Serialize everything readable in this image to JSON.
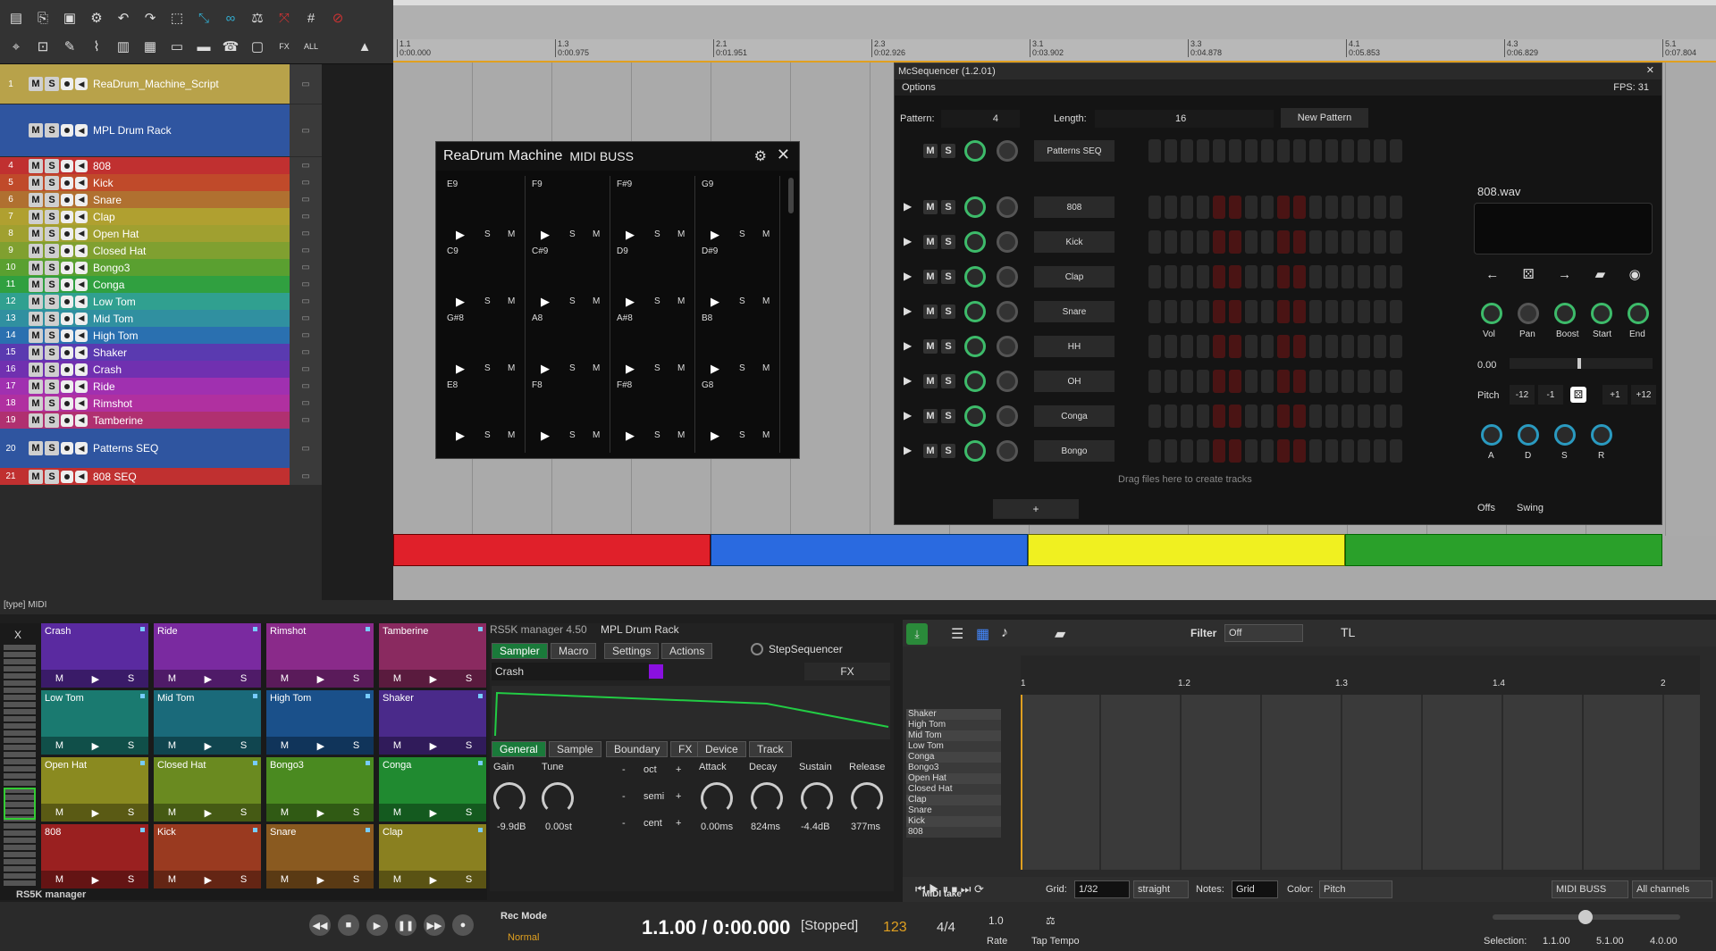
{
  "toolbar": {
    "icons": [
      "new-icon",
      "open-icon",
      "save-icon",
      "settings-icon",
      "undo-icon",
      "redo-icon",
      "select-icon",
      "ripple-icon",
      "link-icon",
      "metronome-icon",
      "snap-icon",
      "grid-icon",
      "lock-icon"
    ]
  },
  "tracks": [
    {
      "num": "1",
      "name": "ReaDrum_Machine_Script",
      "color": "#b8a24a",
      "kind": "A"
    },
    {
      "num": "",
      "name": "MPL Drum Rack",
      "color": "#2f55a0",
      "kind": ""
    },
    {
      "num": "4",
      "name": "808",
      "color": "#c03030"
    },
    {
      "num": "5",
      "name": "Kick",
      "color": "#c04a2a"
    },
    {
      "num": "6",
      "name": "Snare",
      "color": "#b07030"
    },
    {
      "num": "7",
      "name": "Clap",
      "color": "#b0a030"
    },
    {
      "num": "8",
      "name": "Open Hat",
      "color": "#a0a030"
    },
    {
      "num": "9",
      "name": "Closed Hat",
      "color": "#80a030"
    },
    {
      "num": "10",
      "name": "Bongo3",
      "color": "#5aa030"
    },
    {
      "num": "11",
      "name": "Conga",
      "color": "#30a040"
    },
    {
      "num": "12",
      "name": "Low Tom",
      "color": "#30a090"
    },
    {
      "num": "13",
      "name": "Mid Tom",
      "color": "#3090a0"
    },
    {
      "num": "14",
      "name": "High Tom",
      "color": "#2a70b0"
    },
    {
      "num": "15",
      "name": "Shaker",
      "color": "#5a3ab0"
    },
    {
      "num": "16",
      "name": "Crash",
      "color": "#7030b0"
    },
    {
      "num": "17",
      "name": "Ride",
      "color": "#a030b0"
    },
    {
      "num": "18",
      "name": "Rimshot",
      "color": "#b030a0"
    },
    {
      "num": "19",
      "name": "Tamberine",
      "color": "#b03070"
    },
    {
      "num": "20",
      "name": "Patterns SEQ",
      "color": "#2f55a0"
    },
    {
      "num": "21",
      "name": "808 SEQ",
      "color": "#c03030"
    }
  ],
  "tcp_labels": {
    "m": "M",
    "s": "S",
    "a": "A",
    "fx": "FX",
    "midi": "MIDI"
  },
  "ruler": [
    {
      "bar": "1.1",
      "time": "0:00.000"
    },
    {
      "bar": "1.3",
      "time": "0:00.975"
    },
    {
      "bar": "2.1",
      "time": "0:01.951"
    },
    {
      "bar": "2.3",
      "time": "0:02.926"
    },
    {
      "bar": "3.1",
      "time": "0:03.902"
    },
    {
      "bar": "3.3",
      "time": "0:04.878"
    },
    {
      "bar": "4.1",
      "time": "0:05.853"
    },
    {
      "bar": "4.3",
      "time": "0:06.829"
    },
    {
      "bar": "5.1",
      "time": "0:07.804"
    }
  ],
  "type_label": "[type] MIDI",
  "readrum": {
    "title": "ReaDrum Machine",
    "subtitle": "MIDI BUSS",
    "pads_row1": [
      "E9",
      "F9",
      "F#9",
      "G9"
    ],
    "pads_row2": [
      "C9",
      "C#9",
      "D9",
      "D#9"
    ],
    "pads_row3": [
      "G#8",
      "A8",
      "A#8",
      "B8"
    ],
    "pads_row4": [
      "E8",
      "F8",
      "F#8",
      "G8"
    ],
    "s": "S",
    "m": "M"
  },
  "mcseq": {
    "title": "McSequencer (1.2.01)",
    "options": "Options",
    "fps": "FPS: 31",
    "pattern_label": "Pattern:",
    "pattern_val": "4",
    "length_label": "Length:",
    "length_val": "16",
    "new_pattern": "New Pattern",
    "rows": [
      "Patterns SEQ",
      "808",
      "Kick",
      "Clap",
      "Snare",
      "HH",
      "OH",
      "Conga",
      "Bongo"
    ],
    "drag": "Drag files here to create tracks",
    "plus": "+",
    "sample": "808.wav",
    "knobs1": [
      "Vol",
      "Pan",
      "Boost",
      "Start",
      "End"
    ],
    "pitch_val": "0.00",
    "pitch_label": "Pitch",
    "pitch_btns": [
      "-12",
      "-1",
      "+1",
      "+12"
    ],
    "adsr": [
      "A",
      "D",
      "S",
      "R"
    ],
    "offs": "Offs",
    "swing": "Swing",
    "m": "M",
    "s": "S"
  },
  "rs5k_pads": [
    {
      "name": "Crash",
      "color": "#5a2aa0"
    },
    {
      "name": "Ride",
      "color": "#7a2aa0"
    },
    {
      "name": "Rimshot",
      "color": "#8a2a8a"
    },
    {
      "name": "Tamberine",
      "color": "#8a2a60"
    },
    {
      "name": "Low Tom",
      "color": "#1a7a70"
    },
    {
      "name": "Mid Tom",
      "color": "#1a6a7a"
    },
    {
      "name": "High Tom",
      "color": "#1a508a"
    },
    {
      "name": "Shaker",
      "color": "#4a2a8a"
    },
    {
      "name": "Open Hat",
      "color": "#8a8a20"
    },
    {
      "name": "Closed Hat",
      "color": "#6a8a20"
    },
    {
      "name": "Bongo3",
      "color": "#4a8a20"
    },
    {
      "name": "Conga",
      "color": "#208a30"
    },
    {
      "name": "808",
      "color": "#9a2020"
    },
    {
      "name": "Kick",
      "color": "#9a3a20"
    },
    {
      "name": "Snare",
      "color": "#8a5a20"
    },
    {
      "name": "Clap",
      "color": "#8a8020"
    }
  ],
  "rs5k": {
    "x": "X",
    "title": "RS5K manager 4.50",
    "rack": "MPL Drum Rack",
    "footer": "RS5K manager",
    "tabs1": [
      "Sampler",
      "Macro",
      "Settings",
      "Actions"
    ],
    "stepseq": "StepSequencer",
    "current": "Crash",
    "fx": "FX",
    "tabs2": [
      "General",
      "Sample",
      "Boundary",
      "FX",
      "Device",
      "Track"
    ],
    "params": [
      {
        "l": "Gain",
        "v": "-9.9dB"
      },
      {
        "l": "Tune",
        "v": "0.00st"
      }
    ],
    "steps": [
      {
        "l": "oct"
      },
      {
        "l": "semi"
      },
      {
        "l": "cent"
      }
    ],
    "env": [
      {
        "l": "Attack",
        "v": "0.00ms"
      },
      {
        "l": "Decay",
        "v": "824ms"
      },
      {
        "l": "Sustain",
        "v": "-4.4dB"
      },
      {
        "l": "Release",
        "v": "377ms"
      }
    ],
    "minus": "-",
    "plus": "+",
    "m": "M",
    "s": "S"
  },
  "midi": {
    "filter": "Filter",
    "filter_val": "Off",
    "tl": "TL",
    "notes": [
      "Shaker",
      "High Tom",
      "Mid Tom",
      "Low Tom",
      "Conga",
      "Bongo3",
      "Open Hat",
      "Closed Hat",
      "Clap",
      "Snare",
      "Kick",
      "808"
    ],
    "ruler": [
      "1",
      "1.2",
      "1.3",
      "1.4",
      "2"
    ],
    "grid": "Grid:",
    "grid_val": "1/32",
    "straight": "straight",
    "notes_label": "Notes:",
    "notes_val": "Grid",
    "color": "Color:",
    "color_val": "Pitch",
    "bus": "MIDI BUSS",
    "channels": "All channels",
    "take": "MIDI take"
  },
  "transport": {
    "recmode": "Rec Mode",
    "normal": "Normal",
    "pos": "1.1.00 / 0:00.000",
    "state": "[Stopped]",
    "bpm": "123",
    "sig": "4/4",
    "rate_val": "1.0",
    "rate": "Rate",
    "tap": "Tap Tempo",
    "selection": "Selection:",
    "sel1": "1.1.00",
    "sel2": "5.1.00",
    "sel3": "4.0.00"
  }
}
